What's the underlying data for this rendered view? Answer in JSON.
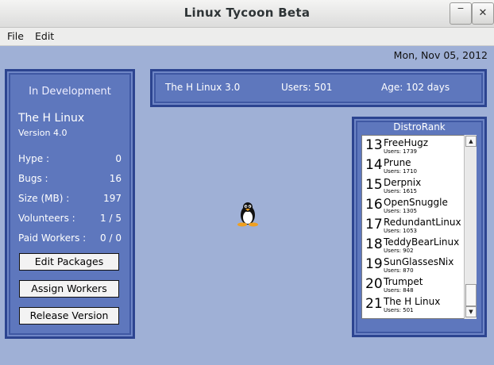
{
  "window": {
    "title": "Linux Tycoon Beta",
    "minimize_glyph": "‾",
    "close_glyph": "✕"
  },
  "menu": {
    "file": "File",
    "edit": "Edit"
  },
  "date": "Mon, Nov 05, 2012",
  "status_bar": {
    "distro": "The H Linux 3.0",
    "users": "Users: 501",
    "age": "Age: 102 days"
  },
  "dev_panel": {
    "heading": "In Development",
    "name": "The H Linux",
    "version": "Version 4.0",
    "stats": [
      {
        "label": "Hype :",
        "value": "0"
      },
      {
        "label": "Bugs :",
        "value": "16"
      },
      {
        "label": "Size (MB) :",
        "value": "197"
      },
      {
        "label": "Volunteers :",
        "value": "1 / 5"
      },
      {
        "label": "Paid Workers :",
        "value": "0 / 0"
      }
    ],
    "buttons": {
      "edit": "Edit Packages",
      "assign": "Assign Workers",
      "release": "Release Version"
    }
  },
  "distrorank": {
    "heading": "DistroRank",
    "items": [
      {
        "rank": "13",
        "name": "FreeHugz",
        "users": "Users: 1739"
      },
      {
        "rank": "14",
        "name": "Prune",
        "users": "Users: 1710"
      },
      {
        "rank": "15",
        "name": "Derpnix",
        "users": "Users: 1615"
      },
      {
        "rank": "16",
        "name": "OpenSnuggle",
        "users": "Users: 1305"
      },
      {
        "rank": "17",
        "name": "RedundantLinux",
        "users": "Users: 1053"
      },
      {
        "rank": "18",
        "name": "TeddyBearLinux",
        "users": "Users: 902"
      },
      {
        "rank": "19",
        "name": "SunGlassesNix",
        "users": "Users: 870"
      },
      {
        "rank": "20",
        "name": "Trumpet",
        "users": "Users: 848"
      },
      {
        "rank": "21",
        "name": "The H Linux",
        "users": "Users: 501"
      }
    ],
    "scroll_up": "▲",
    "scroll_down": "▼"
  },
  "icons": {
    "mascot": "penguin-icon"
  },
  "colors": {
    "canvas": "#9fb0d6",
    "panel": "#5e77bd",
    "panel_border": "#2c4490"
  }
}
